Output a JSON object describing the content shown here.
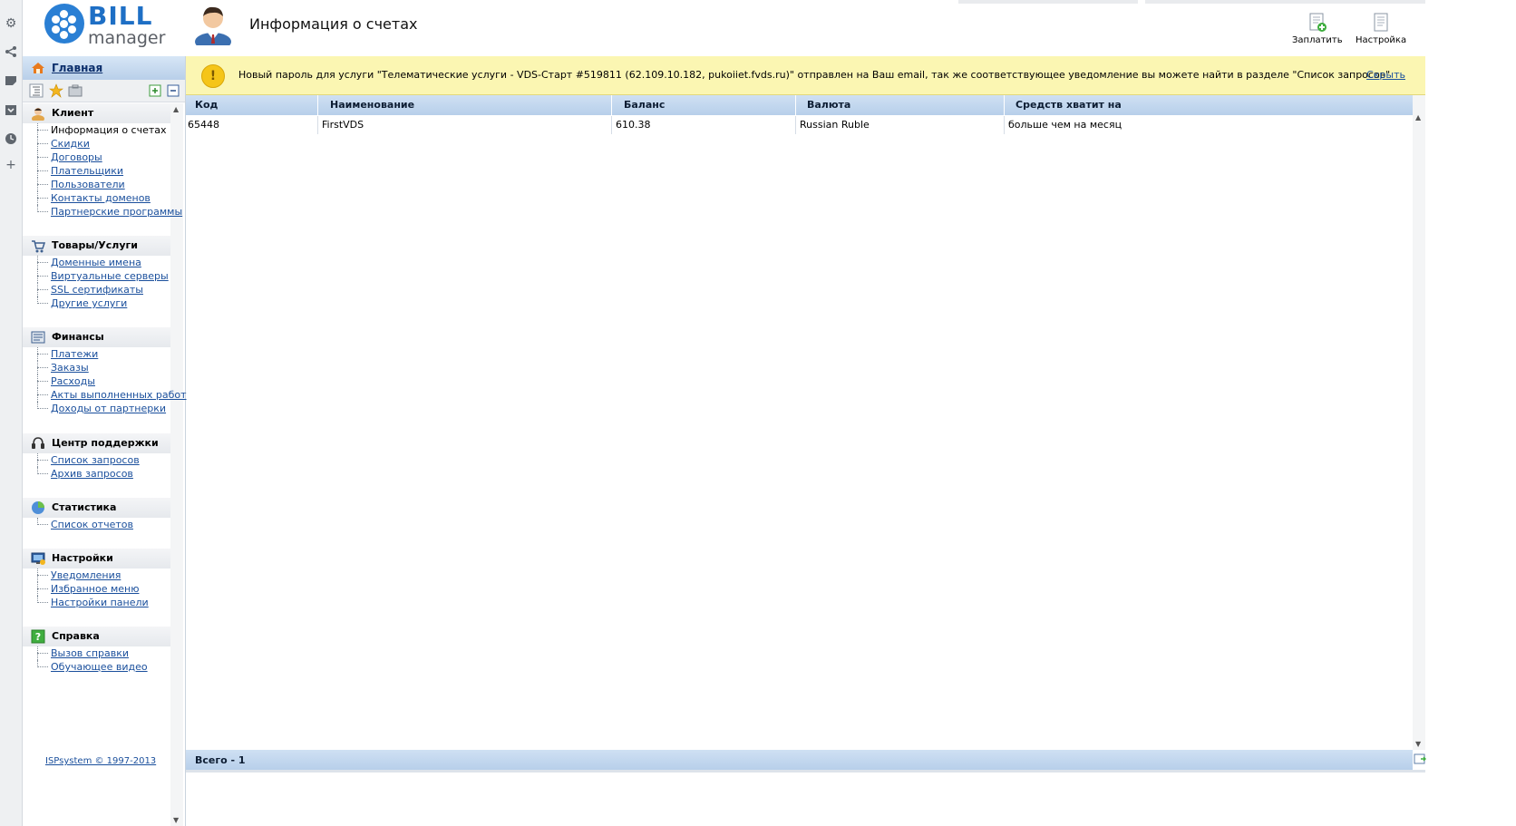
{
  "app": {
    "logo_word1": "BILL",
    "logo_word2": "manager",
    "page_title": "Информация о счетах"
  },
  "header_actions": [
    {
      "label": "Заплатить",
      "icon": "pay-icon"
    },
    {
      "label": "Настройка",
      "icon": "settings-doc-icon"
    }
  ],
  "toolstrip": [
    "gear-icon",
    "share-icon",
    "note-icon",
    "download-icon",
    "clock-icon",
    "plus-icon"
  ],
  "sidebar": {
    "home_label": "Главная",
    "groups": [
      {
        "title": "Клиент",
        "icon": "client-icon",
        "items": [
          "Информация о счетах",
          "Скидки",
          "Договоры",
          "Плательщики",
          "Пользователи",
          "Контакты доменов",
          "Партнерские программы"
        ]
      },
      {
        "title": "Товары/Услуги",
        "icon": "cart-icon",
        "items": [
          "Доменные имена",
          "Виртуальные серверы",
          "SSL сертификаты",
          "Другие услуги"
        ]
      },
      {
        "title": "Финансы",
        "icon": "finance-icon",
        "items": [
          "Платежи",
          "Заказы",
          "Расходы",
          "Акты выполненных работ",
          "Доходы от партнерки"
        ]
      },
      {
        "title": "Центр поддержки",
        "icon": "headset-icon",
        "items": [
          "Список запросов",
          "Архив запросов"
        ]
      },
      {
        "title": "Статистика",
        "icon": "pie-chart-icon",
        "items": [
          "Список отчетов"
        ]
      },
      {
        "title": "Настройки",
        "icon": "monitor-icon",
        "items": [
          "Уведомления",
          "Избранное меню",
          "Настройки панели"
        ]
      },
      {
        "title": "Справка",
        "icon": "help-icon",
        "items": [
          "Вызов справки",
          "Обучающее видео"
        ]
      }
    ],
    "copyright": "ISPsystem © 1997-2013"
  },
  "notice": {
    "text": "Новый пароль для услуги \"Телематические услуги - VDS-Старт #519811 (62.109.10.182, pukoiiet.fvds.ru)\" отправлен на Ваш email, так же соответствующее уведомление вы можете найти в разделе \"Список запросов\"",
    "hide_label": "Скрыть"
  },
  "table": {
    "columns": [
      "Код",
      "Наименование",
      "Баланс",
      "Валюта",
      "Средств хватит на"
    ],
    "rows": [
      [
        "65448",
        "FirstVDS",
        "610.38",
        "Russian Ruble",
        "больше чем на месяц"
      ]
    ],
    "footer": "Всего - 1"
  }
}
